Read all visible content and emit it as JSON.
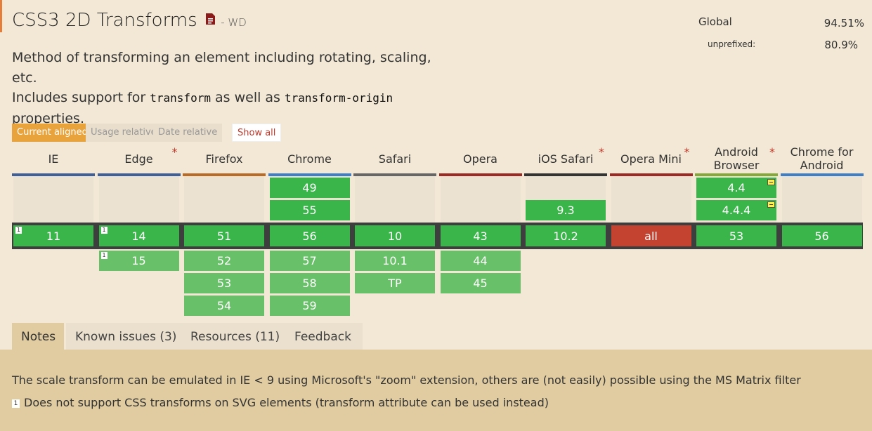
{
  "title": "CSS3 2D Transforms",
  "status": "- WD",
  "description": {
    "line1": "Method of transforming an element including rotating, scaling, etc.",
    "line2_pre": "Includes support for ",
    "code1": "transform",
    "line2_mid": " as well as ",
    "code2": "transform-origin",
    "line3": "properties."
  },
  "usage": {
    "global_label": "Global",
    "global_value": "94.51%",
    "unprefixed_label": "unprefixed:",
    "unprefixed_value": "80.9%"
  },
  "view_buttons": {
    "current": "Current aligned",
    "usage": "Usage relative",
    "date": "Date relative",
    "show_all": "Show all"
  },
  "browsers": [
    {
      "name": "IE",
      "star": "",
      "bar": "#3f5f99"
    },
    {
      "name": "Edge",
      "star": "*",
      "bar": "#3f5f99"
    },
    {
      "name": "Firefox",
      "star": "",
      "bar": "#b86b26"
    },
    {
      "name": "Chrome",
      "star": "",
      "bar": "#3f7fc6"
    },
    {
      "name": "Safari",
      "star": "",
      "bar": "#666666"
    },
    {
      "name": "Opera",
      "star": "",
      "bar": "#9b2a25"
    },
    {
      "name": "iOS Safari",
      "star": "*",
      "bar": "#333333"
    },
    {
      "name": "Opera Mini",
      "star": "*",
      "bar": "#9b2a25"
    },
    {
      "name": "Android Browser",
      "star": "*",
      "bar": "#84a93a"
    },
    {
      "name": "Chrome for Android",
      "star": "",
      "bar": "#3f7fc6"
    }
  ],
  "past": {
    "chrome": [
      "49",
      "55"
    ],
    "ios_safari": [
      "9.3"
    ],
    "android": [
      "4.4",
      "4.4.4"
    ]
  },
  "current": [
    "11",
    "14",
    "51",
    "56",
    "10",
    "43",
    "10.2",
    "all",
    "53",
    "56"
  ],
  "future": {
    "edge": [
      "15"
    ],
    "firefox": [
      "52",
      "53",
      "54"
    ],
    "chrome": [
      "57",
      "58",
      "59"
    ],
    "safari": [
      "10.1",
      "TP"
    ],
    "opera": [
      "44",
      "45"
    ]
  },
  "note_marker": "1",
  "tabs": [
    "Notes",
    "Known issues (3)",
    "Resources (11)",
    "Feedback"
  ],
  "notes": {
    "text": "The scale transform can be emulated in IE < 9 using Microsoft's \"zoom\" extension, others are (not easily) possible using the MS Matrix filter",
    "footnote_num": "1",
    "footnote": "Does not support CSS transforms on SVG elements (transform attribute can be used instead)"
  },
  "colors": {
    "supported": "#39b54a",
    "supported_future": "#68c068",
    "unsupported": "#c44230",
    "accent": "#e8a33c"
  }
}
